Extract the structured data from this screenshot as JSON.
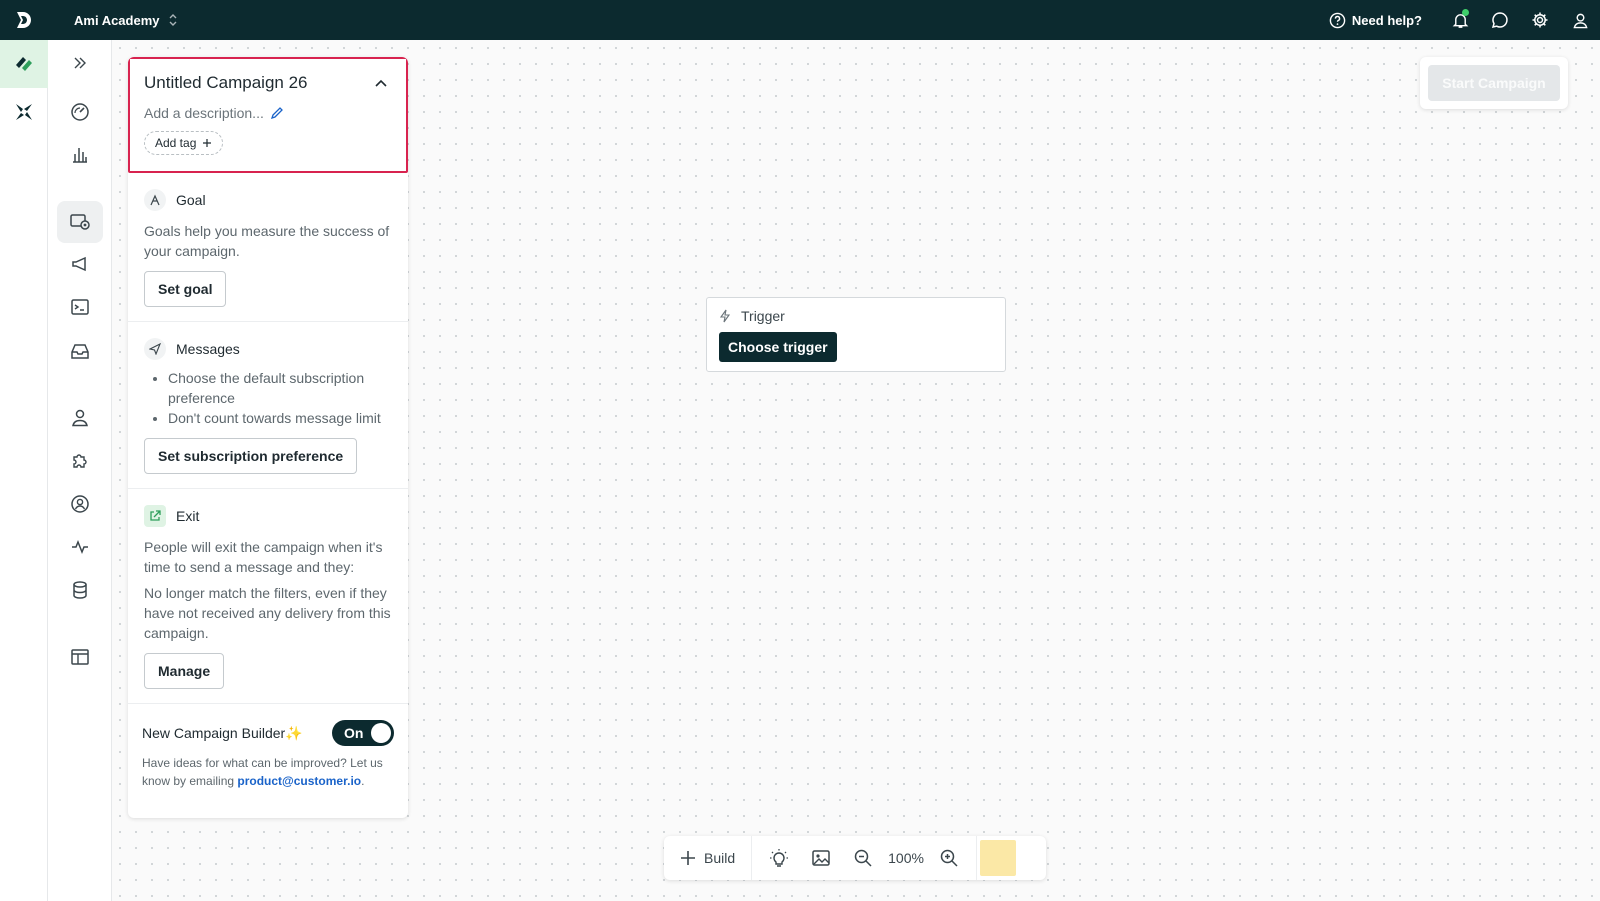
{
  "topbar": {
    "workspace_name": "Ami Academy",
    "help_label": "Need help?"
  },
  "campaign": {
    "title": "Untitled Campaign 26",
    "description_placeholder": "Add a description...",
    "add_tag_label": "Add tag"
  },
  "goal": {
    "heading": "Goal",
    "text": "Goals help you measure the success of your campaign.",
    "button": "Set goal"
  },
  "messages": {
    "heading": "Messages",
    "bullets": [
      "Choose the default subscription preference",
      "Don't count towards message limit"
    ],
    "button": "Set subscription preference"
  },
  "exit": {
    "heading": "Exit",
    "text1": "People will exit the campaign when it's time to send a message and they:",
    "text2": "No longer match the filters, even if they have not received any delivery from this campaign.",
    "button": "Manage"
  },
  "builder": {
    "label": "New Campaign Builder",
    "sparkle": "✨",
    "toggle_state": "On",
    "note_prefix": "Have ideas for what can be improved? Let us know by emailing ",
    "email": "product@customer.io",
    "note_suffix": "."
  },
  "start_button": "Start Campaign",
  "trigger": {
    "label": "Trigger",
    "button": "Choose trigger"
  },
  "toolbar": {
    "build_label": "Build",
    "zoom_level": "100%"
  },
  "icons": {
    "nav1": [
      "campaigns-logo-icon",
      "cross-app-icon"
    ],
    "nav2": [
      "expand-icon",
      "dashboard-gauge-icon",
      "analytics-bar-icon",
      "campaigns-journey-icon",
      "broadcast-megaphone-icon",
      "transactional-terminal-icon",
      "inbox-tray-icon",
      "people-icon",
      "integrations-puzzle-icon",
      "accounts-icon",
      "activity-pulse-icon",
      "data-database-icon",
      "table-icon"
    ]
  },
  "colors": {
    "topbar": "#0c2a2f",
    "highlight_border": "#d8234f",
    "link": "#1a63c9",
    "active_rail": "#dff3e4"
  }
}
